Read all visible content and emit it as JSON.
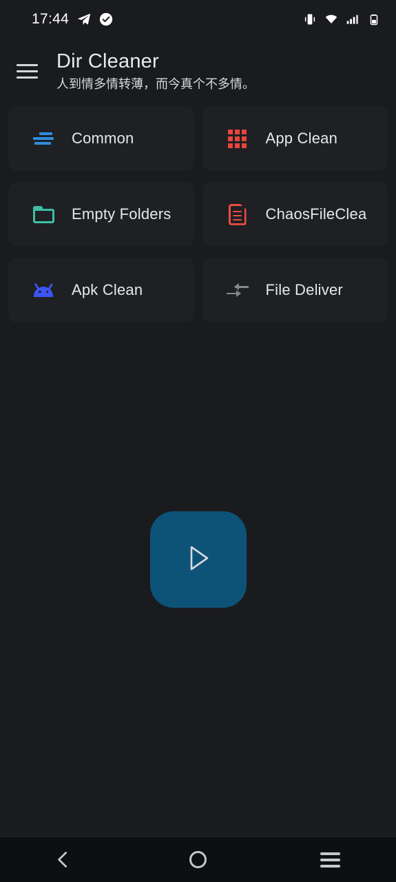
{
  "status_bar": {
    "time": "17:44",
    "left_icons": [
      "telegram-icon",
      "check-circle-icon"
    ],
    "right_icons": [
      "vibrate-icon",
      "wifi-icon",
      "cellular-signal-icon",
      "battery-icon"
    ]
  },
  "app_bar": {
    "menu_icon": "hamburger-menu-icon",
    "title": "Dir Cleaner",
    "subtitle": "人到情多情转薄，而今真个不多情。"
  },
  "grid": {
    "items": [
      {
        "label": "Common",
        "icon": "sort-lines-icon",
        "color": "#2f8ce0"
      },
      {
        "label": "App Clean",
        "icon": "apps-grid-icon",
        "color": "#e8453c"
      },
      {
        "label": "Empty Folders",
        "icon": "folder-icon",
        "color": "#40bda4"
      },
      {
        "label": "ChaosFileClea",
        "icon": "document-icon",
        "color": "#ef4b43"
      },
      {
        "label": "Apk Clean",
        "icon": "android-robot-icon",
        "color": "#3d54f5"
      },
      {
        "label": "File Deliver",
        "icon": "transfer-arrows-icon",
        "color": "#85888c"
      }
    ]
  },
  "fab": {
    "icon": "play-triangle-icon",
    "background": "#0d5377"
  },
  "nav_bar": {
    "back": "back-chevron-icon",
    "home": "home-circle-icon",
    "recents": "recents-lines-icon"
  },
  "theme": {
    "page_background": "#1a1b1e",
    "card_background": "#1e2023",
    "text_primary": "#e6e8ea"
  }
}
